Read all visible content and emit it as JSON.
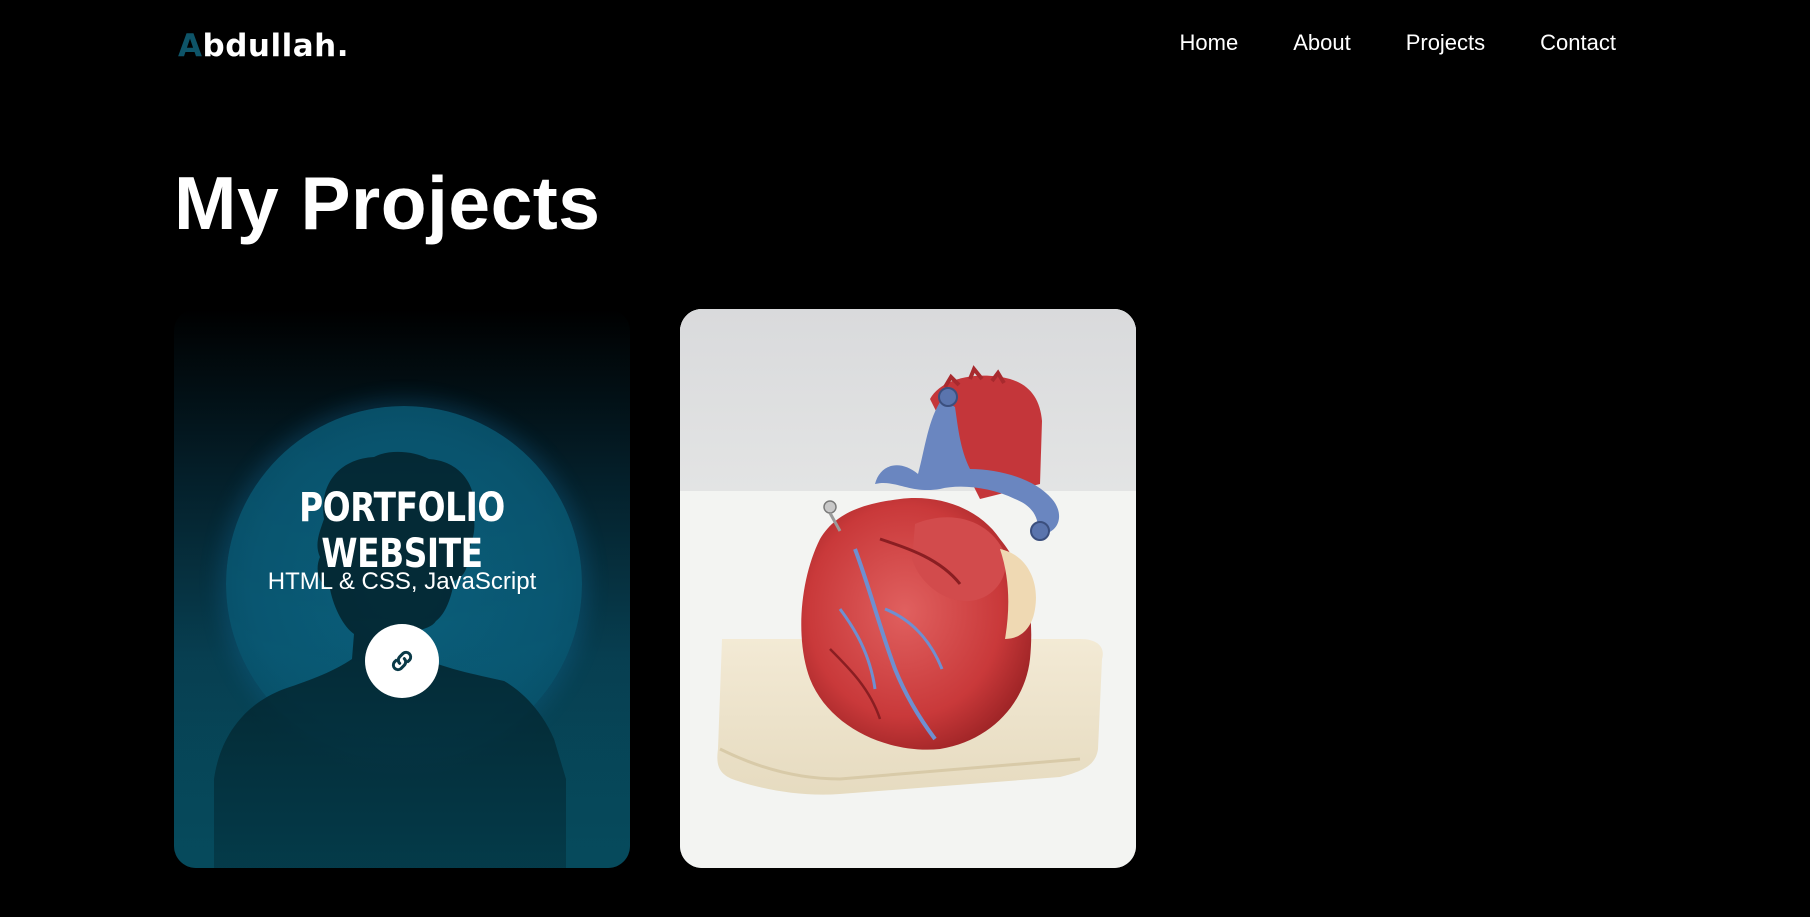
{
  "header": {
    "logo_first": "A",
    "logo_rest": "bdullah.",
    "nav": [
      {
        "label": "Home"
      },
      {
        "label": "About"
      },
      {
        "label": "Projects"
      },
      {
        "label": "Contact"
      }
    ]
  },
  "main": {
    "title": "My Projects",
    "projects": [
      {
        "title": "Portfolio Website",
        "tech": "HTML & CSS, JavaScript",
        "link_icon": "link-icon"
      },
      {
        "image": "anatomical-heart-model"
      }
    ]
  },
  "colors": {
    "background": "#000000",
    "accent": "#0e5468",
    "card_teal": "#064a5c",
    "text": "#ffffff"
  }
}
